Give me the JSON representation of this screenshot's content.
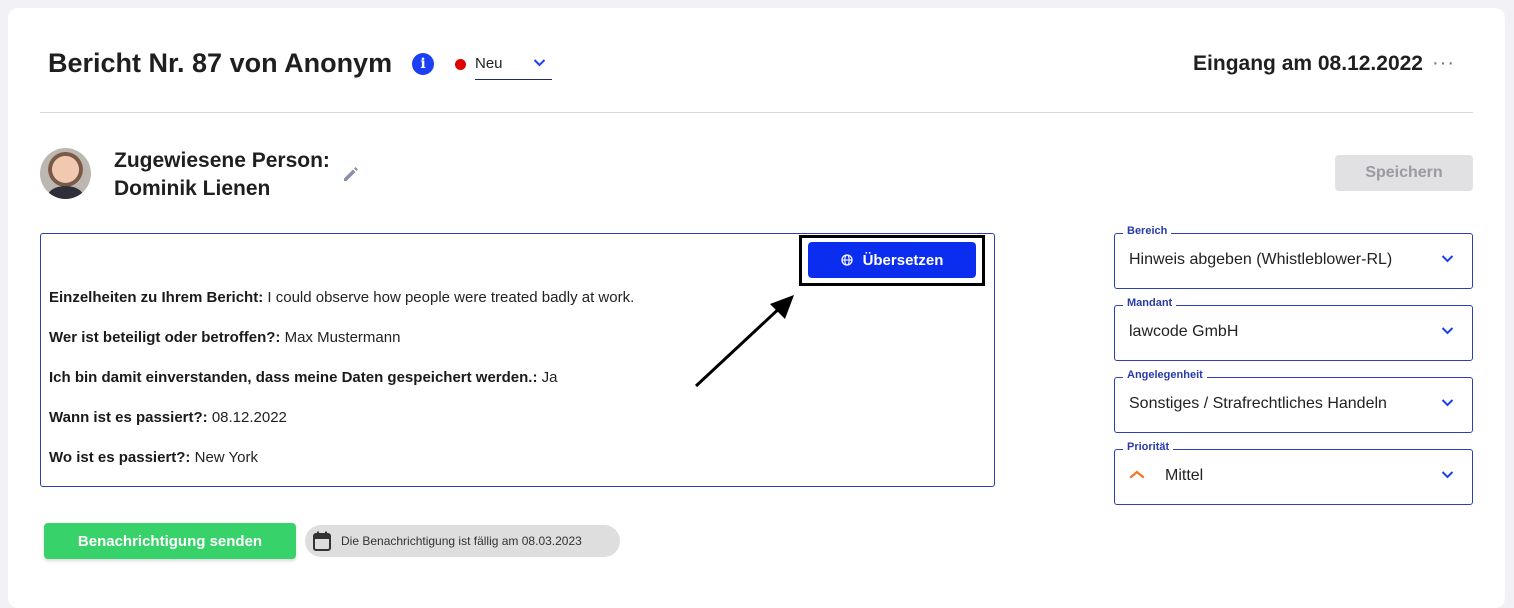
{
  "header": {
    "title": "Bericht Nr. 87 von Anonym",
    "status": "Neu",
    "received": "Eingang am 08.12.2022",
    "more": "···"
  },
  "assignee": {
    "line1": "Zugewiesene Person:",
    "line2": "Dominik Lienen"
  },
  "save_label": "Speichern",
  "translate_label": "Übersetzen",
  "report": [
    {
      "label": "Einzelheiten zu Ihrem Bericht:",
      "value": " I could observe how people were treated badly at work."
    },
    {
      "label": "Wer ist beteiligt oder betroffen?:",
      "value": " Max Mustermann"
    },
    {
      "label": "Ich bin damit einverstanden, dass meine Daten gespeichert werden.:",
      "value": " Ja"
    },
    {
      "label": "Wann ist es passiert?:",
      "value": " 08.12.2022"
    },
    {
      "label": "Wo ist es passiert?:",
      "value": " New York"
    }
  ],
  "fields": {
    "bereich": {
      "label": "Bereich",
      "value": "Hinweis abgeben (Whistleblower-RL)"
    },
    "mandant": {
      "label": "Mandant",
      "value": "lawcode GmbH"
    },
    "angelegenheit": {
      "label": "Angelegenheit",
      "value": "Sonstiges / Strafrechtliches Handeln"
    },
    "prioritaet": {
      "label": "Priorität",
      "value": "Mittel"
    }
  },
  "notify_label": "Benachrichtigung senden",
  "due_text": "Die Benachrichtigung ist fällig am 08.03.2023",
  "colors": {
    "accent": "#0a2df0",
    "status_dot": "#e00000",
    "notify": "#37d36a",
    "priority": "#f07a2a"
  }
}
